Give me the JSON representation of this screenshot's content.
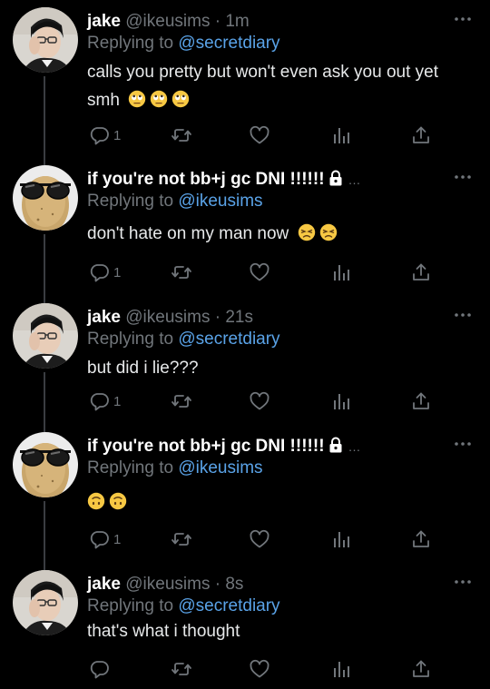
{
  "app": {
    "colors": {
      "background": "#000000",
      "text": "#e7e9ea",
      "muted": "#71767b",
      "mention": "#5aa3e8",
      "thread_line": "#3a3d41"
    }
  },
  "tweets": [
    {
      "name": "jake",
      "handle": "@ikeusims",
      "separator": "·",
      "time": "1m",
      "reply_prefix": "Replying to",
      "reply_to": "@secretdiary",
      "text_line1": "calls you pretty but won't even ask you out yet",
      "text_line2": "smh",
      "emoji": [
        "rolling-eyes-face-icon",
        "rolling-eyes-face-icon",
        "rolling-eyes-face-icon"
      ],
      "reply_count": "1",
      "avatar_icon": "jake-avatar-icon"
    },
    {
      "name": "if you're not bb+j gc DNI !!!!!!",
      "locked": true,
      "truncation": "…",
      "reply_prefix": "Replying to",
      "reply_to": "@ikeusims",
      "text": "don't hate on my man now",
      "emoji": [
        "persevering-face-icon",
        "persevering-face-icon"
      ],
      "reply_count": "1",
      "avatar_icon": "potato-sunglasses-avatar-icon"
    },
    {
      "name": "jake",
      "handle": "@ikeusims",
      "separator": "·",
      "time": "21s",
      "reply_prefix": "Replying to",
      "reply_to": "@secretdiary",
      "text": "but did i lie???",
      "reply_count": "1",
      "avatar_icon": "jake-avatar-icon"
    },
    {
      "name": "if you're not bb+j gc DNI !!!!!!",
      "locked": true,
      "truncation": "…",
      "reply_prefix": "Replying to",
      "reply_to": "@ikeusims",
      "text": "",
      "emoji": [
        "upside-down-face-icon",
        "upside-down-face-icon"
      ],
      "reply_count": "1",
      "avatar_icon": "potato-sunglasses-avatar-icon"
    },
    {
      "name": "jake",
      "handle": "@ikeusims",
      "separator": "·",
      "time": "8s",
      "reply_prefix": "Replying to",
      "reply_to": "@secretdiary",
      "text": "that's what i thought",
      "reply_count": "",
      "avatar_icon": "jake-avatar-icon"
    }
  ]
}
